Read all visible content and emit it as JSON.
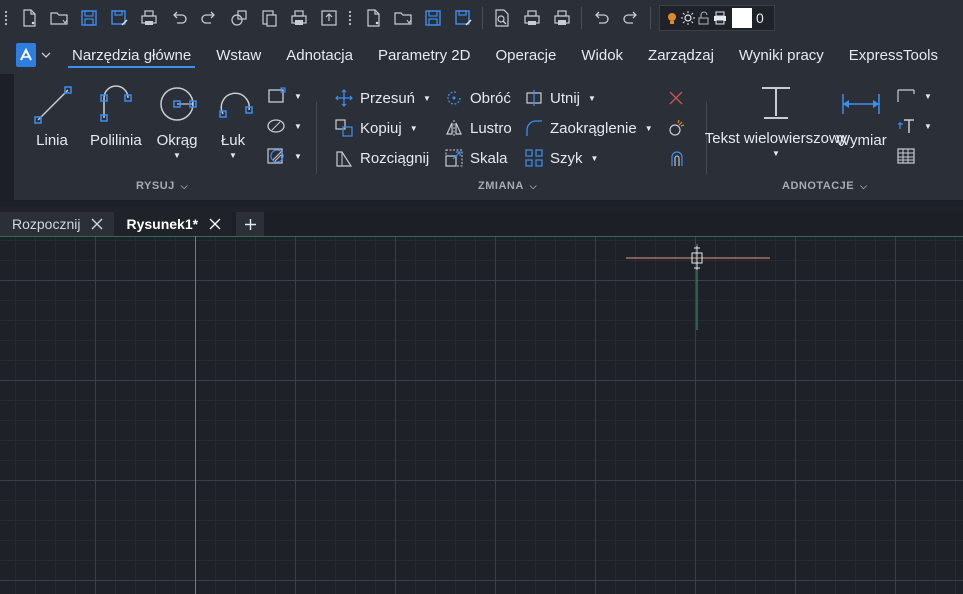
{
  "quick_access": {
    "tools_group1": [
      "new-file-icon",
      "open-folder-icon",
      "save-icon",
      "save-as-icon",
      "plot-icon",
      "undo-icon",
      "redo-icon",
      "block-icon",
      "paste-icon",
      "print-icon",
      "export-icon"
    ],
    "tools_group2": [
      "new-file-icon",
      "open-folder-icon",
      "save-icon",
      "save-as-icon"
    ],
    "tools_group3": [
      "print-preview-icon",
      "plot-icon",
      "print-icon"
    ],
    "tools_group4": [
      "undo-icon",
      "redo-icon"
    ],
    "layer": {
      "name": "0",
      "color": "#ffffff"
    }
  },
  "ribbon_tabs": [
    {
      "label": "Narzędzia główne",
      "active": true
    },
    {
      "label": "Wstaw",
      "active": false
    },
    {
      "label": "Adnotacja",
      "active": false
    },
    {
      "label": "Parametry 2D",
      "active": false
    },
    {
      "label": "Operacje",
      "active": false
    },
    {
      "label": "Widok",
      "active": false
    },
    {
      "label": "Zarządzaj",
      "active": false
    },
    {
      "label": "Wyniki pracy",
      "active": false
    },
    {
      "label": "ExpressTools",
      "active": false
    }
  ],
  "panels": {
    "draw": {
      "title": "RYSUJ",
      "linia": "Linia",
      "polilinia": "Polilinia",
      "okrag": "Okrąg",
      "luk": "Łuk"
    },
    "modify": {
      "title": "ZMIANA",
      "przesun": "Przesuń",
      "obroc": "Obróć",
      "utnij": "Utnij",
      "kopiuj": "Kopiuj",
      "lustro": "Lustro",
      "zaokraglenie": "Zaokrąglenie",
      "rozciagnij": "Rozciągnij",
      "skala": "Skala",
      "szyk": "Szyk"
    },
    "annotation": {
      "title": "ADNOTACJE",
      "tekst": "Tekst wielowierszowy",
      "wymiar": "Wymiar"
    }
  },
  "document_tabs": [
    {
      "label": "Rozpocznij",
      "active": false
    },
    {
      "label": "Rysunek1*",
      "active": true
    }
  ],
  "colors": {
    "accent": "#3d8ef0",
    "axis_y": "#2fa36b",
    "axis_x": "#e0a080",
    "delete_red": "#d9534f"
  }
}
